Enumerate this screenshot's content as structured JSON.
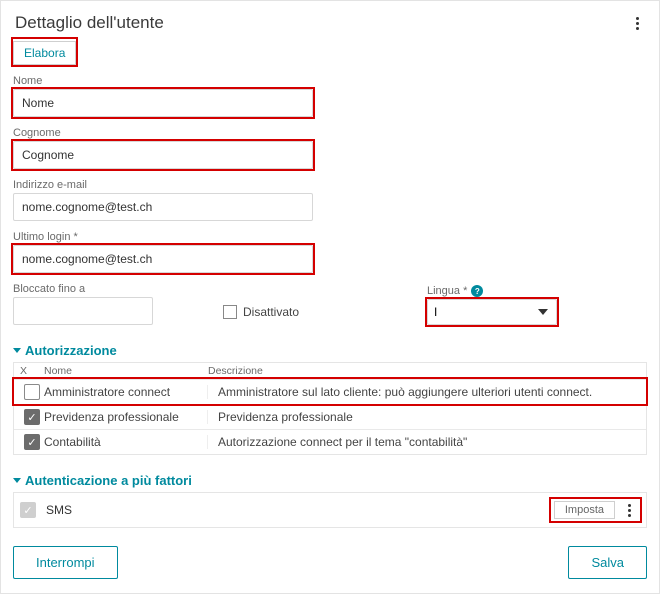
{
  "header": {
    "title": "Dettaglio dell'utente"
  },
  "buttons": {
    "elabora": "Elabora",
    "interrompi": "Interrompi",
    "salva": "Salva",
    "imposta": "Imposta"
  },
  "fields": {
    "nome": {
      "label": "Nome",
      "value": "Nome"
    },
    "cognome": {
      "label": "Cognome",
      "value": "Cognome"
    },
    "email": {
      "label": "Indirizzo e-mail",
      "value": "nome.cognome@test.ch"
    },
    "ultimo_login": {
      "label": "Ultimo login *",
      "value": "nome.cognome@test.ch"
    },
    "bloccato": {
      "label": "Bloccato fino a",
      "value": ""
    },
    "disattivato": {
      "label": "Disattivato"
    },
    "lingua": {
      "label": "Lingua *",
      "value": "I"
    }
  },
  "auth_section": {
    "title": "Autorizzazione",
    "columns": {
      "x": "X",
      "nome": "Nome",
      "desc": "Descrizione"
    },
    "rows": [
      {
        "checked": false,
        "nome": "Amministratore connect",
        "desc": "Amministratore sul lato cliente: può aggiungere ulteriori utenti connect."
      },
      {
        "checked": true,
        "nome": "Previdenza professionale",
        "desc": "Previdenza professionale"
      },
      {
        "checked": true,
        "nome": "Contabilità",
        "desc": "Autorizzazione connect per il tema \"contabilità\""
      }
    ]
  },
  "mfa_section": {
    "title": "Autenticazione a più fattori",
    "sms": "SMS"
  }
}
